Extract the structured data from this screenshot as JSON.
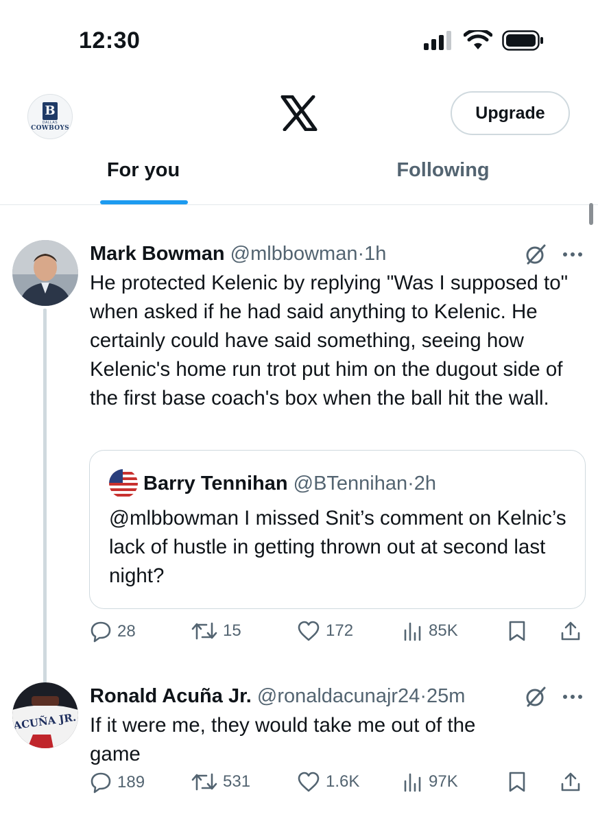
{
  "status_bar": {
    "time": "12:30"
  },
  "header": {
    "profile_avatar_logo": "COWBOYS",
    "profile_avatar_sublabel": "DALLAS",
    "upgrade_label": "Upgrade"
  },
  "tabs": [
    {
      "label": "For you",
      "selected": true
    },
    {
      "label": "Following",
      "selected": false
    }
  ],
  "colors": {
    "accent": "#1d9bf0",
    "secondary_text": "#536471",
    "border": "#cfd9de"
  },
  "tweets": [
    {
      "display_name": "Mark Bowman",
      "handle": "@mlbbowman",
      "separator": "·",
      "time": "1h",
      "text": "He protected Kelenic by replying \"Was I supposed to\" when asked if he had said anything to Kelenic. He certainly could have said something, seeing how Kelenic's home run trot put him on the dugout side of the first base coach's box when the ball hit the wall.",
      "quote": {
        "display_name": "Barry Tennihan",
        "handle": "@BTennihan",
        "separator": "·",
        "time": "2h",
        "text": "@mlbbowman I missed Snit’s comment on Kelnic’s lack of hustle in getting thrown out at second last night?"
      },
      "stats": {
        "replies": "28",
        "reposts": "15",
        "likes": "172",
        "views": "85K"
      }
    },
    {
      "display_name": "Ronald Acuña Jr.",
      "handle": "@ronaldacunajr24",
      "separator": "·",
      "time": "25m",
      "text": "If it were me, they would take me out of the game",
      "jersey_text": "ACUÑA JR.",
      "stats": {
        "replies": "189",
        "reposts": "531",
        "likes": "1.6K",
        "views": "97K"
      }
    }
  ]
}
